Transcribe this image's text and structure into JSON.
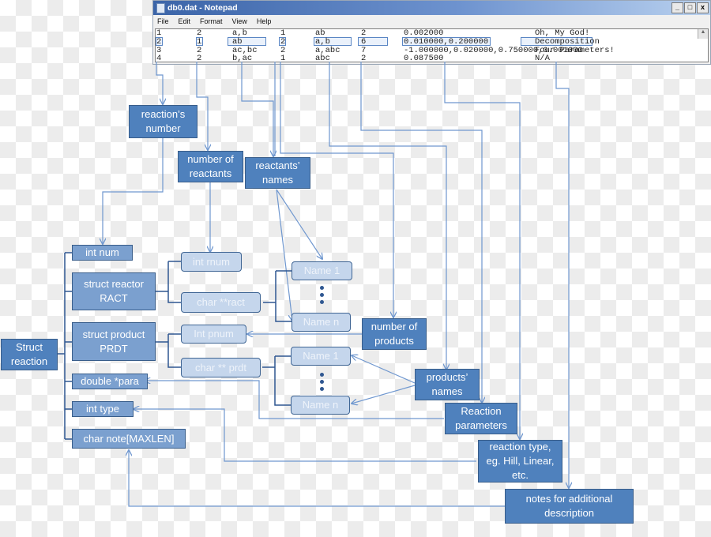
{
  "notepad": {
    "title": "db0.dat - Notepad",
    "controls": [
      "_",
      "□",
      "x"
    ],
    "menu": [
      "File",
      "Edit",
      "Format",
      "View",
      "Help"
    ],
    "rows": [
      [
        "1",
        "2",
        "a,b",
        "1",
        "ab",
        "2",
        "0.002000",
        "Oh, My God!"
      ],
      [
        "2",
        "1",
        "ab",
        "2",
        "a,b",
        "6",
        "0.010000,0.200000",
        "Decomposition"
      ],
      [
        "3",
        "2",
        "ac,bc",
        "2",
        "a,abc",
        "7",
        "-1.000000,0.020000,0.750000,0.001000",
        "Four Parameters!"
      ],
      [
        "4",
        "2",
        "b,ac",
        "1",
        "abc",
        "2",
        "0.087500",
        "N/A"
      ]
    ]
  },
  "annotations": {
    "reaction_number": "reaction’s number",
    "number_of_reactants": "number of reactants",
    "reactants_names": "reactants’ names",
    "number_of_products": "number of products",
    "products_names": "products’ names",
    "reaction_parameters": "Reaction parameters",
    "reaction_type": "reaction type, eg. Hill, Linear, etc.",
    "notes": "notes for additional description"
  },
  "struct": {
    "root": "Struct reaction",
    "fields": {
      "int_num": "int num",
      "ract": "struct reactor RACT",
      "prdt": "struct product PRDT",
      "para": "double *para",
      "type": "int type",
      "note": "char note[MAXLEN]"
    },
    "ract_fields": {
      "rnum": "int rnum",
      "ract": "char **ract"
    },
    "prdt_fields": {
      "pnum": "Int pnum",
      "prdt": "char ** prdt"
    },
    "names": {
      "first": "Name 1",
      "last": "Name n"
    }
  }
}
